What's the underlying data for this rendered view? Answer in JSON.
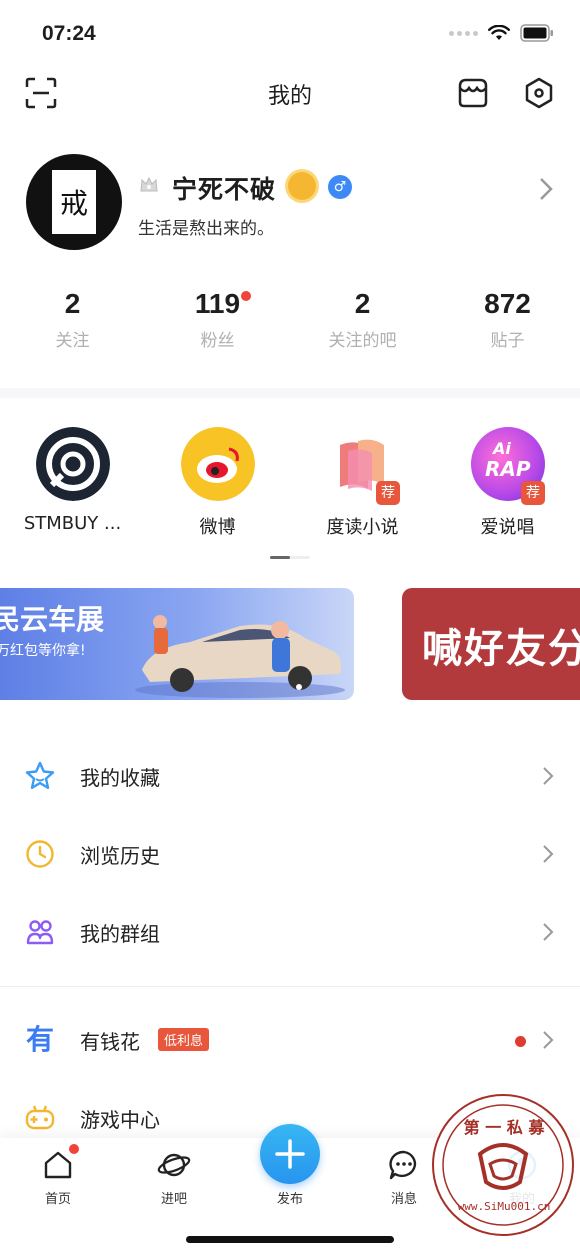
{
  "status_bar": {
    "time": "07:24"
  },
  "nav": {
    "title": "我的"
  },
  "profile": {
    "username": "宁死不破",
    "bio": "生活是熬出来的。",
    "avatar_char": "戒",
    "gender_symbol": "♂"
  },
  "stats": [
    {
      "value": "2",
      "label": "关注"
    },
    {
      "value": "119",
      "label": "粉丝"
    },
    {
      "value": "2",
      "label": "关注的吧"
    },
    {
      "value": "872",
      "label": "贴子"
    }
  ],
  "apps": [
    {
      "label": "STMBUY ...",
      "icon": "stmbuy-icon"
    },
    {
      "label": "微博",
      "icon": "weibo-icon"
    },
    {
      "label": "度读小说",
      "icon": "dudu-novel-icon",
      "badge": "荐"
    },
    {
      "label": "爱说唱",
      "icon": "ai-rap-icon",
      "badge": "荐",
      "icon_text_1": "Ai",
      "icon_text_2": "RAP"
    }
  ],
  "banners": {
    "left_title": "民云车展",
    "left_subtitle": "万红包等你拿!",
    "right_title": "喊好友分"
  },
  "menu": [
    {
      "label": "我的收藏",
      "icon": "star-icon"
    },
    {
      "label": "浏览历史",
      "icon": "clock-icon"
    },
    {
      "label": "我的群组",
      "icon": "group-icon"
    },
    {
      "label": "有钱花",
      "icon": "youqianhua-icon",
      "tag": "低利息",
      "icon_char": "有"
    },
    {
      "label": "游戏中心",
      "icon": "gamepad-icon"
    }
  ],
  "tabbar": [
    {
      "label": "首页",
      "icon": "home-icon"
    },
    {
      "label": "进吧",
      "icon": "planet-icon"
    },
    {
      "label": "发布",
      "icon": "plus-icon"
    },
    {
      "label": "消息",
      "icon": "message-icon"
    },
    {
      "label": "我的",
      "icon": "profile-icon"
    }
  ],
  "watermark": {
    "top_text": "第 一 私 募",
    "url_text": "www.SiMu001.cn"
  },
  "colors": {
    "accent_blue": "#2795f0",
    "red_dot": "#f04438",
    "tag_red": "#e8573c"
  }
}
